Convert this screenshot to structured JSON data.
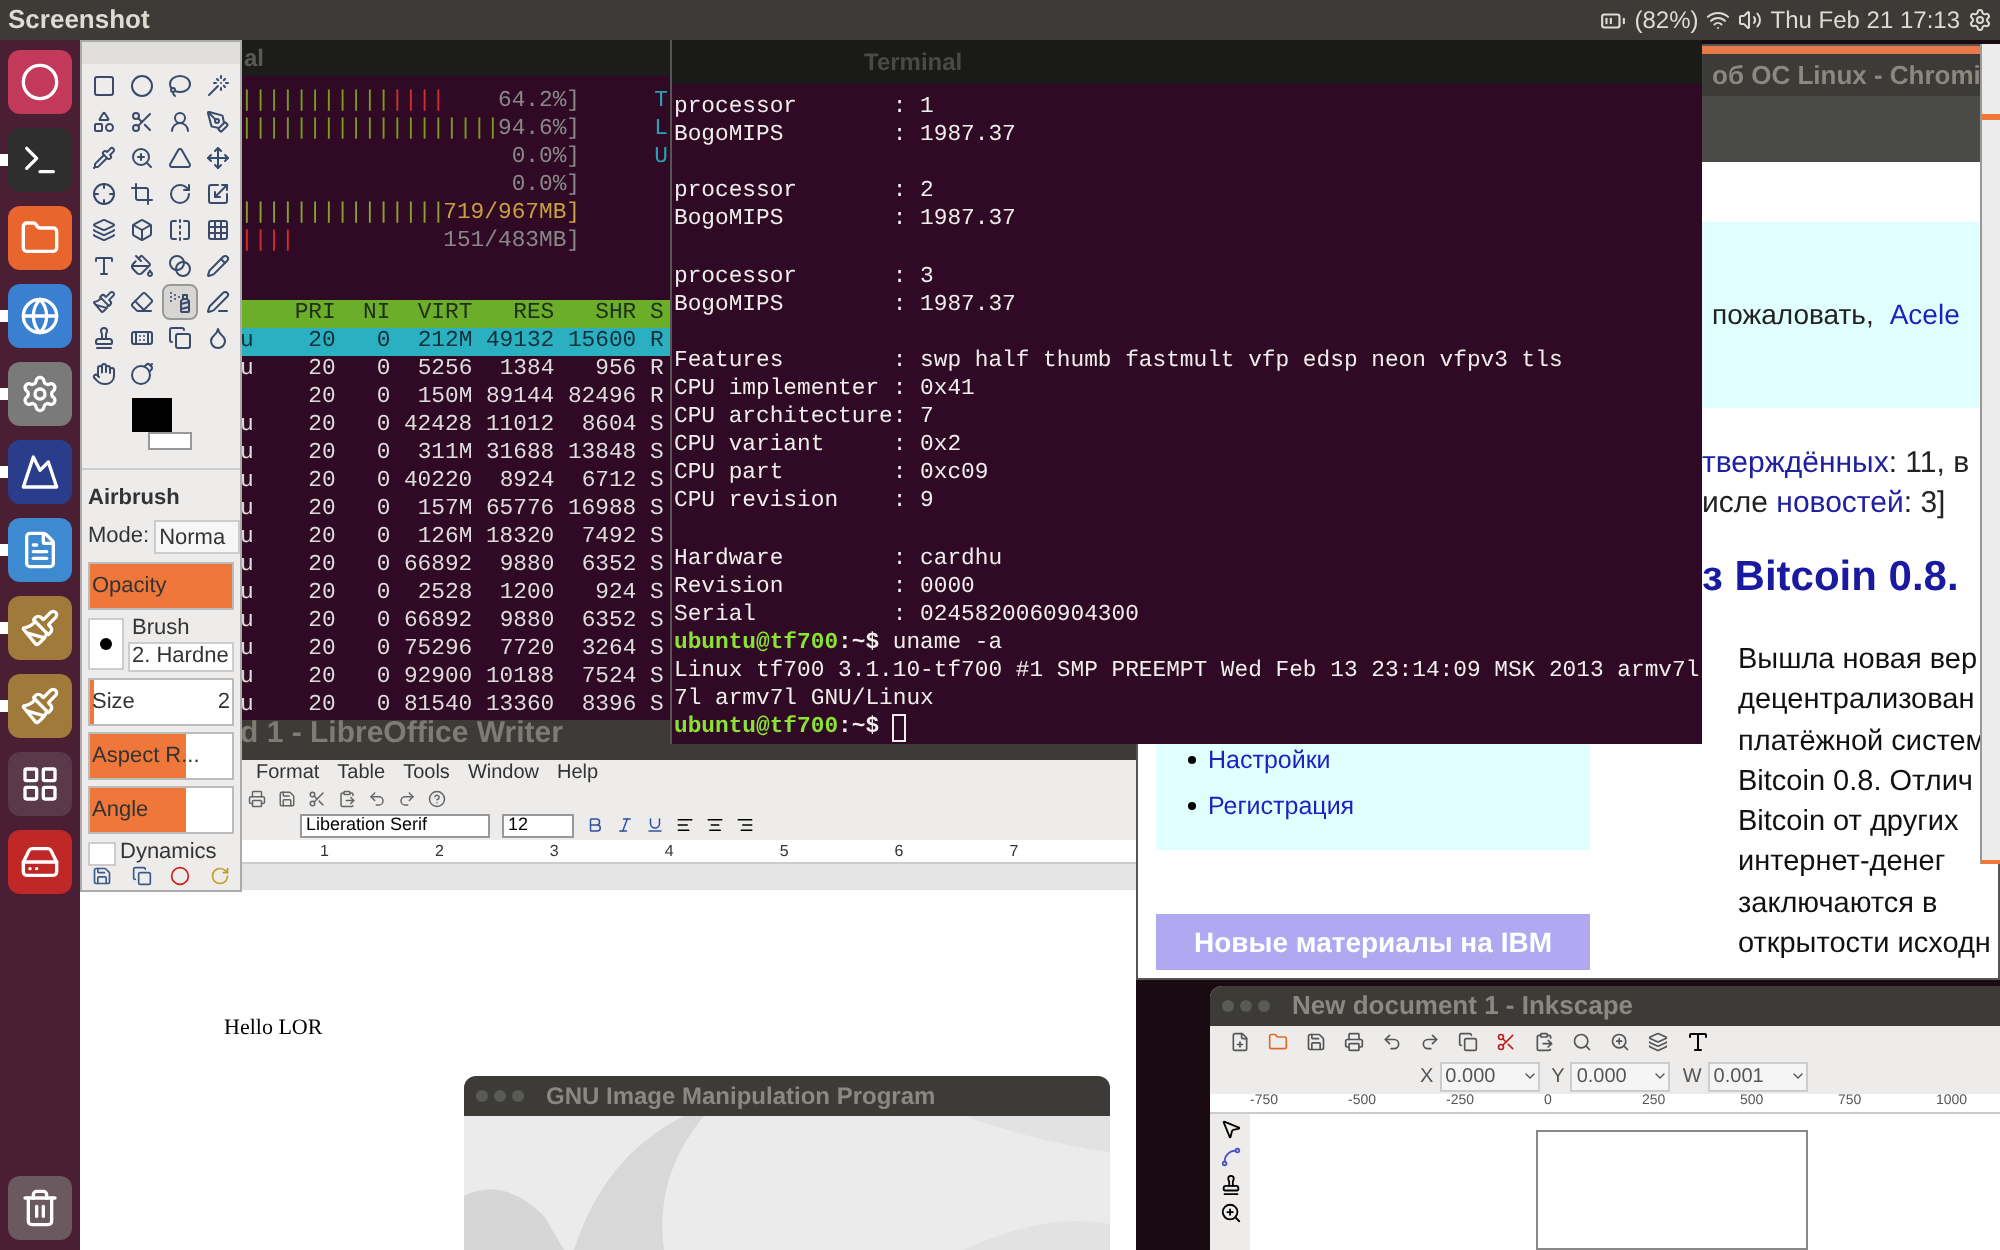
{
  "top_panel": {
    "title": "Screenshot",
    "battery": "(82%)",
    "clock": "Thu Feb 21 17:13"
  },
  "launcher": [
    {
      "running": false
    },
    {
      "running": true
    },
    {
      "running": false
    },
    {
      "running": true
    },
    {
      "running": true
    },
    {
      "running": true
    },
    {
      "running": true
    },
    {
      "running": true
    },
    {
      "running": true
    },
    {
      "running": false
    },
    {
      "running": false
    },
    {
      "running": false
    }
  ],
  "gimp_toolbox": {
    "tools": [
      {
        "selected": false
      },
      {
        "selected": false
      },
      {
        "selected": false
      },
      {
        "selected": false
      },
      {
        "selected": false
      },
      {
        "selected": false
      },
      {
        "selected": false
      },
      {
        "selected": false
      },
      {
        "selected": false
      },
      {
        "selected": false
      },
      {
        "selected": false
      },
      {
        "selected": false
      },
      {
        "selected": false
      },
      {
        "selected": false
      },
      {
        "selected": false
      },
      {
        "selected": false
      },
      {
        "selected": false
      },
      {
        "selected": false
      },
      {
        "selected": false
      },
      {
        "selected": false
      },
      {
        "selected": false
      },
      {
        "selected": false
      },
      {
        "selected": false
      },
      {
        "selected": false
      },
      {
        "selected": false
      },
      {
        "selected": false
      },
      {
        "selected": true
      },
      {
        "selected": false
      },
      {
        "selected": false
      },
      {
        "selected": false
      },
      {
        "selected": false
      },
      {
        "selected": false
      },
      {
        "selected": false
      },
      {
        "selected": false
      }
    ],
    "tool_name": "Airbrush",
    "mode_label": "Mode:",
    "mode_value": "Norma",
    "opacity": {
      "label": "Opacity",
      "level": 1
    },
    "brush": {
      "label": "Brush",
      "value": "2. Hardne"
    },
    "size": {
      "label": "Size",
      "value": "2",
      "level": 0.03
    },
    "aspect": {
      "label": "Aspect R...",
      "level": 0.67
    },
    "angle": {
      "label": "Angle",
      "level": 0.67
    },
    "dynamics": {
      "label": "Dynamics"
    }
  },
  "htop": {
    "title": "al",
    "meters": [
      {
        "kind": "cpu",
        "bar": "|||||||||||",
        "bar_tail": "||||",
        "reading": "64.2%]",
        "side_label": "T"
      },
      {
        "kind": "cpu",
        "bar": "|||||||||||||||||||",
        "reading": "94.6%]",
        "side_label": "L"
      },
      {
        "kind": "cpu",
        "reading": "0.0%]",
        "side_label": "U"
      },
      {
        "kind": "cpu",
        "reading": "0.0%]"
      },
      {
        "kind": "mem",
        "bar": "|||||||||||||||",
        "reading": "719/967MB]"
      },
      {
        "kind": "swap",
        "bar": "||||",
        "reading": "151/483MB]"
      }
    ],
    "columns": [
      "PRI",
      "NI",
      "VIRT",
      "RES",
      "SHR",
      "S"
    ],
    "rows": [
      {
        "user": "u",
        "cells": [
          "20",
          "0",
          "212M",
          "49132",
          "15600",
          "R"
        ],
        "selected": true
      },
      {
        "user": "u",
        "cells": [
          "20",
          "0",
          "5256",
          "1384",
          "956",
          "R"
        ],
        "selected": false
      },
      {
        "cells": [
          "20",
          "0",
          "150M",
          "89144",
          "82496",
          "R"
        ],
        "selected": false
      },
      {
        "user": "u",
        "cells": [
          "20",
          "0",
          "42428",
          "11012",
          "8604",
          "S"
        ],
        "selected": false
      },
      {
        "user": "u",
        "cells": [
          "20",
          "0",
          "311M",
          "31688",
          "13848",
          "S"
        ],
        "selected": false
      },
      {
        "user": "u",
        "cells": [
          "20",
          "0",
          "40220",
          "8924",
          "6712",
          "S"
        ],
        "selected": false
      },
      {
        "user": "u",
        "cells": [
          "20",
          "0",
          "157M",
          "65776",
          "16988",
          "S"
        ],
        "selected": false
      },
      {
        "user": "u",
        "cells": [
          "20",
          "0",
          "126M",
          "18320",
          "7492",
          "S"
        ],
        "selected": false
      },
      {
        "user": "u",
        "cells": [
          "20",
          "0",
          "66892",
          "9880",
          "6352",
          "S"
        ],
        "selected": false
      },
      {
        "user": "u",
        "cells": [
          "20",
          "0",
          "2528",
          "1200",
          "924",
          "S"
        ],
        "selected": false
      },
      {
        "user": "u",
        "cells": [
          "20",
          "0",
          "66892",
          "9880",
          "6352",
          "S"
        ],
        "selected": false
      },
      {
        "user": "u",
        "cells": [
          "20",
          "0",
          "75296",
          "7720",
          "3264",
          "S"
        ],
        "selected": false
      },
      {
        "user": "u",
        "cells": [
          "20",
          "0",
          "92900",
          "10188",
          "7524",
          "S"
        ],
        "selected": false
      },
      {
        "user": "u",
        "cells": [
          "20",
          "0",
          "81540",
          "13360",
          "8396",
          "S"
        ],
        "selected": false
      }
    ]
  },
  "terminal": {
    "title": "Terminal",
    "lines": [
      {
        "kind": "text",
        "text": "processor       : 1"
      },
      {
        "kind": "text",
        "text": "BogoMIPS        : 1987.37"
      },
      {
        "kind": "gap"
      },
      {
        "kind": "text",
        "text": "processor       : 2"
      },
      {
        "kind": "text",
        "text": "BogoMIPS        : 1987.37"
      },
      {
        "kind": "gap"
      },
      {
        "kind": "text",
        "text": "processor       : 3"
      },
      {
        "kind": "text",
        "text": "BogoMIPS        : 1987.37"
      },
      {
        "kind": "gap"
      },
      {
        "kind": "text",
        "text": "Features        : swp half thumb fastmult vfp edsp neon vfpv3 tls"
      },
      {
        "kind": "text",
        "text": "CPU implementer : 0x41"
      },
      {
        "kind": "text",
        "text": "CPU architecture: 7"
      },
      {
        "kind": "text",
        "text": "CPU variant     : 0x2"
      },
      {
        "kind": "text",
        "text": "CPU part        : 0xc09"
      },
      {
        "kind": "text",
        "text": "CPU revision    : 9"
      },
      {
        "kind": "gap"
      },
      {
        "kind": "text",
        "text": "Hardware        : cardhu"
      },
      {
        "kind": "text",
        "text": "Revision        : 0000"
      },
      {
        "kind": "text",
        "text": "Serial          : 0245820060904300"
      },
      {
        "kind": "prompt",
        "user": "ubuntu@tf700",
        "path": ":~$",
        "command": "uname -a"
      },
      {
        "kind": "text",
        "text": "Linux tf700 3.1.10-tf700 #1 SMP PREEMPT Wed Feb 13 23:14:09 MSK 2013 armv7l"
      },
      {
        "kind": "text",
        "text": "7l armv7l GNU/Linux"
      },
      {
        "kind": "prompt",
        "user": "ubuntu@tf700",
        "path": ":~$"
      }
    ]
  },
  "chromium": {
    "title": "об ОС Linux - Chromi",
    "welcome": "пожаловать,",
    "user_link": "Acele",
    "stats_link": "тверждённых",
    "stats_rest": ": 11, в",
    "news_prefix": "исле ",
    "news_link": "новостей",
    "news_rest": ": 3]",
    "heading": "з Bitcoin 0.8.",
    "paragraph_lines": [
      "Вышла новая вер",
      "децентрализован",
      "платёжной систем",
      "Bitcoin 0.8. Отлич",
      "Bitcoin от других",
      "интернет-денег",
      "заключаются в",
      "открытости исходн"
    ],
    "menu_links": [
      "Настройки",
      "Регистрация"
    ],
    "section_title": "Новые материалы на IBM"
  },
  "writer": {
    "title": "d 1 - LibreOffice Writer",
    "menu": [
      "Format",
      "Table",
      "Tools",
      "Window",
      "Help"
    ],
    "font_name": "Liberation Serif",
    "font_size": "12",
    "ruler": [
      "1",
      "2",
      "3",
      "4",
      "5",
      "6",
      "7"
    ],
    "body": "Hello LOR"
  },
  "gimp_splash": {
    "title": "GNU Image Manipulation Program"
  },
  "inkscape": {
    "title": "New document 1 - Inkscape",
    "fields": [
      {
        "label": "X",
        "value": "0.000"
      },
      {
        "label": "Y",
        "value": "0.000"
      },
      {
        "label": "W",
        "value": "0.001"
      }
    ],
    "ruler": [
      "-750",
      "-500",
      "-250",
      "0",
      "250",
      "500",
      "750",
      "1000"
    ]
  }
}
